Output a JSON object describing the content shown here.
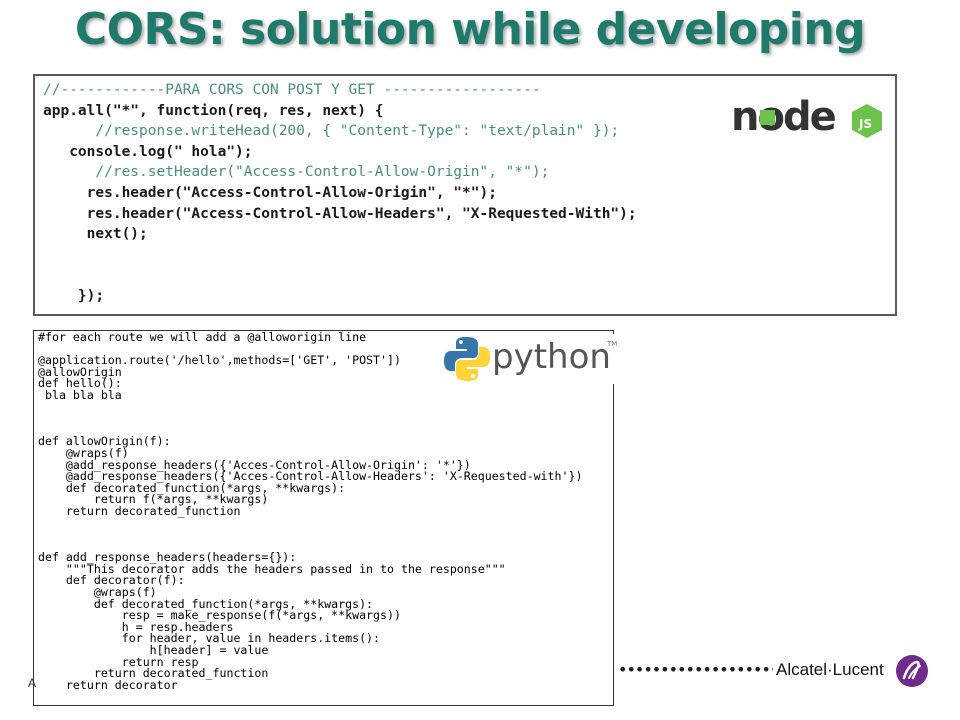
{
  "slide": {
    "title": "CORS: solution while developing",
    "left_fragment": "A"
  },
  "node_panel": {
    "logo_icon": "nodejs-logo",
    "logo_text": "node",
    "logo_js": "JS",
    "lines": [
      "//------------PARA CORS CON POST Y GET ------------------",
      "app.all(\"*\", function(req, res, next) {",
      "      //response.writeHead(200, { \"Content-Type\": \"text/plain\" });",
      "   console.log(\" hola\");",
      "      //res.setHeader(\"Access-Control-Allow-Origin\", \"*\");",
      "     res.header(\"Access-Control-Allow-Origin\", \"*\");",
      "     res.header(\"Access-Control-Allow-Headers\", \"X-Requested-With\");",
      "     next();",
      "",
      "",
      "    });"
    ]
  },
  "python_panel": {
    "logo_icon": "python-logo",
    "logo_word": "python",
    "logo_tm": "TM",
    "lines": [
      "#for each route we will add a @alloworigin line",
      "",
      "@application.route('/hello',methods=['GET', 'POST'])",
      "@allowOrigin",
      "def hello():",
      " bla bla bla",
      "",
      "",
      "",
      "def allowOrigin(f):",
      "    @wraps(f)",
      "    @add_response_headers({'Acces-Control-Allow-Origin': '*'})",
      "    @add_response_headers({'Acces-Control-Allow-Headers': 'X-Requested-with'})",
      "    def decorated_function(*args, **kwargs):",
      "        return f(*args, **kwargs)",
      "    return decorated_function",
      "",
      "",
      "",
      "def add_response_headers(headers={}):",
      "    \"\"\"This decorator adds the headers passed in to the response\"\"\"",
      "    def decorator(f):",
      "        @wraps(f)",
      "        def decorated_function(*args, **kwargs):",
      "            resp = make_response(f(*args, **kwargs))",
      "            h = resp.headers",
      "            for header, value in headers.items():",
      "                h[header] = value",
      "            return resp",
      "        return decorated_function",
      "    return decorator"
    ]
  },
  "footer": {
    "dots": "••••••••••••••••••••••••••••",
    "brand": "Alcatel·Lucent",
    "brand_icon": "alcatel-lucent-logo"
  },
  "colors": {
    "title": "#1f7a6c",
    "comment": "#4a8f7a",
    "keyword": "#7a1fa2",
    "string": "#1d2fa8",
    "node_green": "#6cc24a",
    "python_blue": "#3776ab",
    "python_yellow": "#ffd43b",
    "brand_purple": "#6e2a8d"
  }
}
